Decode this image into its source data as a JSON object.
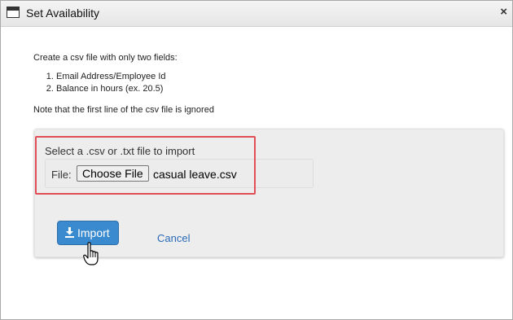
{
  "dialog": {
    "title": "Set Availability",
    "close_glyph": "×",
    "icon": "window-icon"
  },
  "instructions": {
    "intro": "Create a csv file with only two fields:",
    "fields": [
      "Email Address/Employee Id",
      "Balance in hours (ex. 20.5)"
    ],
    "note": "Note that the first line of the csv file is ignored"
  },
  "import_panel": {
    "select_label": "Select a .csv or .txt file to import",
    "file_label": "File:",
    "choose_button_label": "Choose File",
    "selected_file": "casual leave.csv",
    "highlight_color": "#e24e55"
  },
  "actions": {
    "import_label": "Import",
    "import_icon": "download-icon",
    "cancel_label": "Cancel",
    "primary_color": "#3a8ad0",
    "link_color": "#2a6ab8"
  },
  "pointer": {
    "icon": "hand-cursor-icon"
  }
}
